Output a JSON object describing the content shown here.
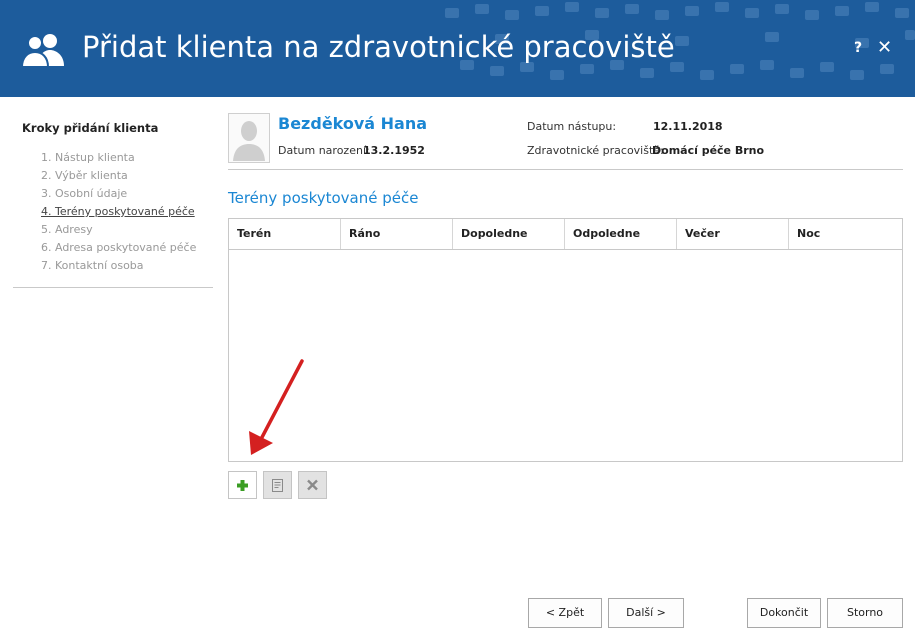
{
  "window": {
    "title": "Přidat klienta na zdravotnické pracoviště",
    "help_label": "?",
    "close_label": "✕",
    "brand_color": "#1d5c9c",
    "icon": "users-icon"
  },
  "steps": {
    "title": "Kroky přidání klienta",
    "items": [
      {
        "label": "1. Nástup klienta"
      },
      {
        "label": "2. Výběr klienta"
      },
      {
        "label": "3. Osobní údaje"
      },
      {
        "label": "4. Terény poskytované péče",
        "active": true
      },
      {
        "label": "5. Adresy"
      },
      {
        "label": "6. Adresa poskytované péče"
      },
      {
        "label": "7. Kontaktní osoba"
      }
    ]
  },
  "client": {
    "name": "Bezděková Hana",
    "birth_label": "Datum narození:",
    "birth_value": "13.2.1952",
    "entry_label": "Datum nástupu:",
    "entry_value": "12.11.2018",
    "workplace_label": "Zdravotnické pracoviště:",
    "workplace_value": "Domácí péče Brno"
  },
  "section": {
    "title": "Terény poskytované péče"
  },
  "grid": {
    "columns": [
      "Terén",
      "Ráno",
      "Dopoledne",
      "Odpoledne",
      "Večer",
      "Noc"
    ],
    "rows": []
  },
  "grid_actions": {
    "add_icon": "plus-icon",
    "edit_icon": "edit-icon",
    "delete_icon": "delete-icon",
    "add_color": "#3a9d23"
  },
  "footer": {
    "back_label": "< Zpět",
    "next_label": "Další >",
    "finish_label": "Dokončit",
    "cancel_label": "Storno"
  },
  "annotation": {
    "arrow_color": "#d42020",
    "points_to": "add-row-button"
  }
}
